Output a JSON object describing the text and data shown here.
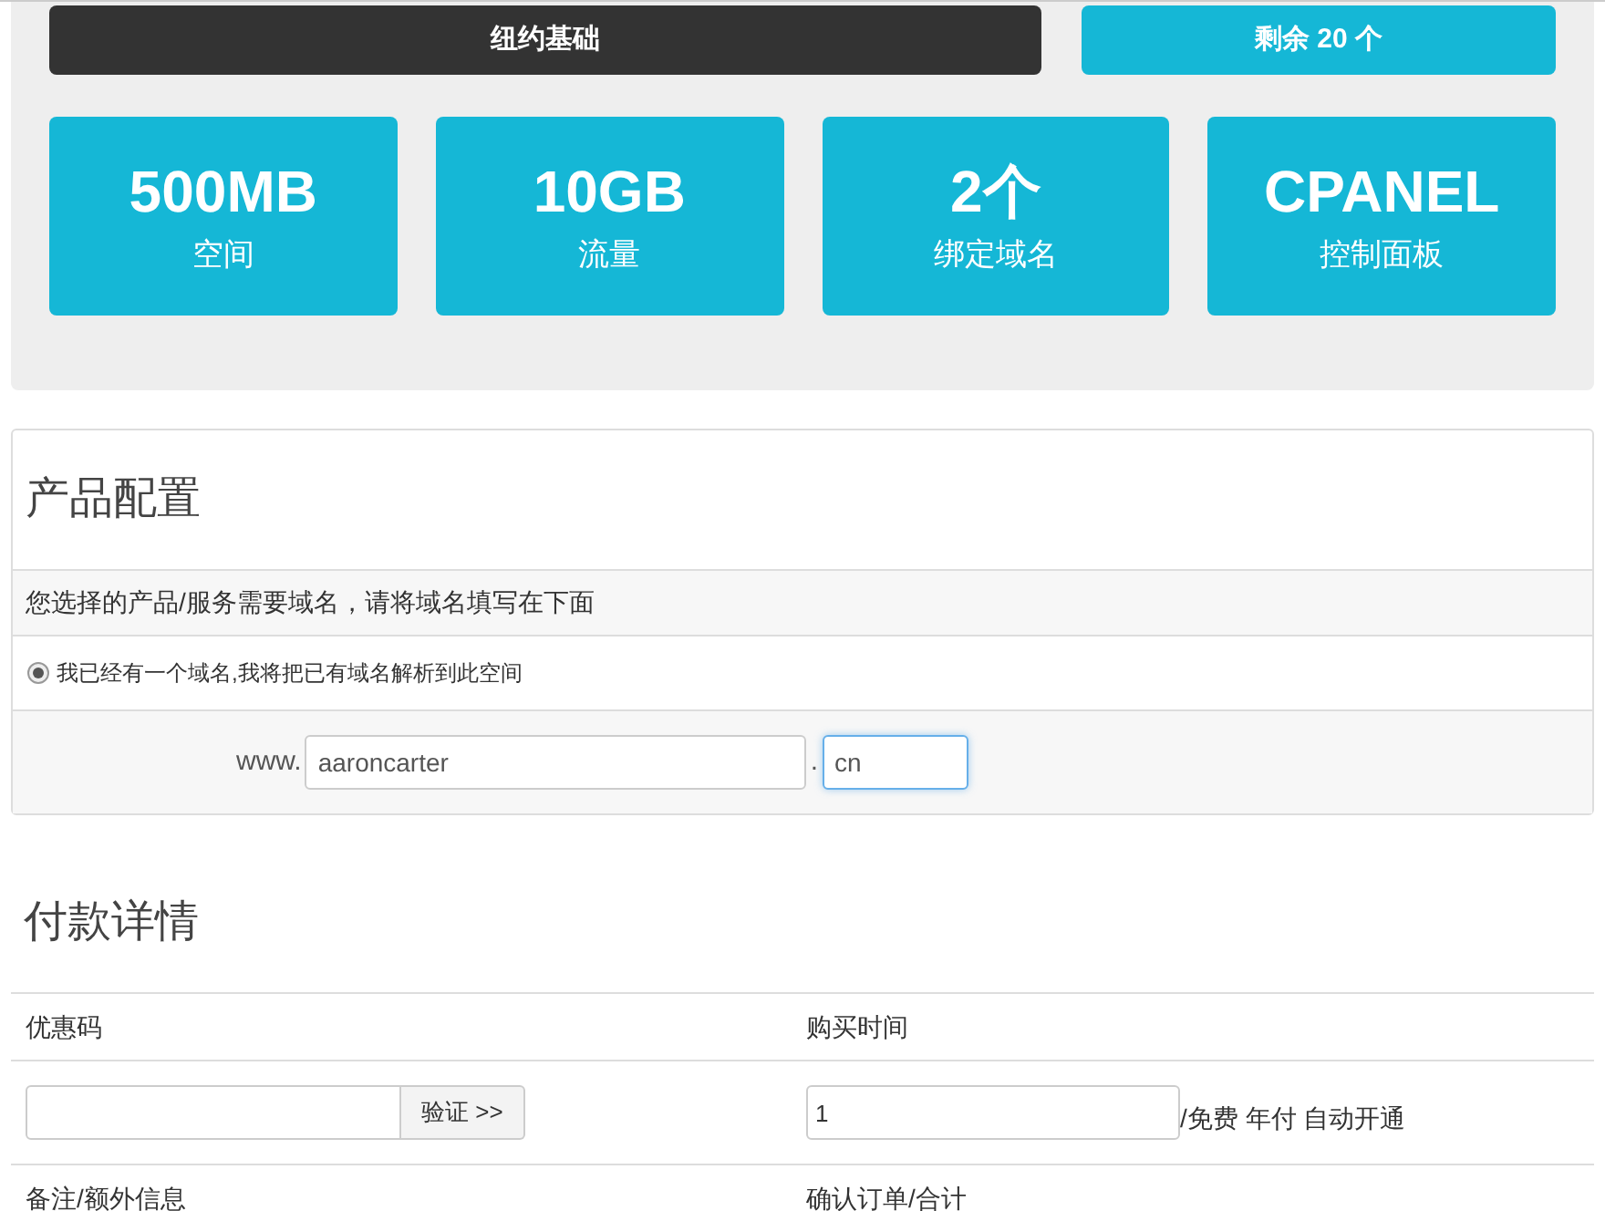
{
  "plan": {
    "name": "纽约基础",
    "stock": "剩余 20 个"
  },
  "features": [
    {
      "value": "500MB",
      "label": "空间"
    },
    {
      "value": "10GB",
      "label": "流量"
    },
    {
      "value": "2个",
      "label": "绑定域名"
    },
    {
      "value": "CPANEL",
      "label": "控制面板"
    }
  ],
  "config": {
    "title": "产品配置",
    "notice": "您选择的产品/服务需要域名，请将域名填写在下面",
    "options": [
      {
        "label": "我已经有一个域名,我将把已有域名解析到此空间",
        "selected": true
      }
    ],
    "prefix": "www.",
    "domain": "aaroncarter",
    "separator": ".",
    "tld": {
      "value": "cn",
      "focused": true
    }
  },
  "payment": {
    "title": "付款详情",
    "coupon_label": "优惠码",
    "verify_button": "验证 >>",
    "period_label": "购买时间",
    "period_value": "1",
    "period_suffix": "/免费 年付 自动开通",
    "notes_label": "备注/额外信息",
    "confirm_label": "确认订单/合计"
  }
}
